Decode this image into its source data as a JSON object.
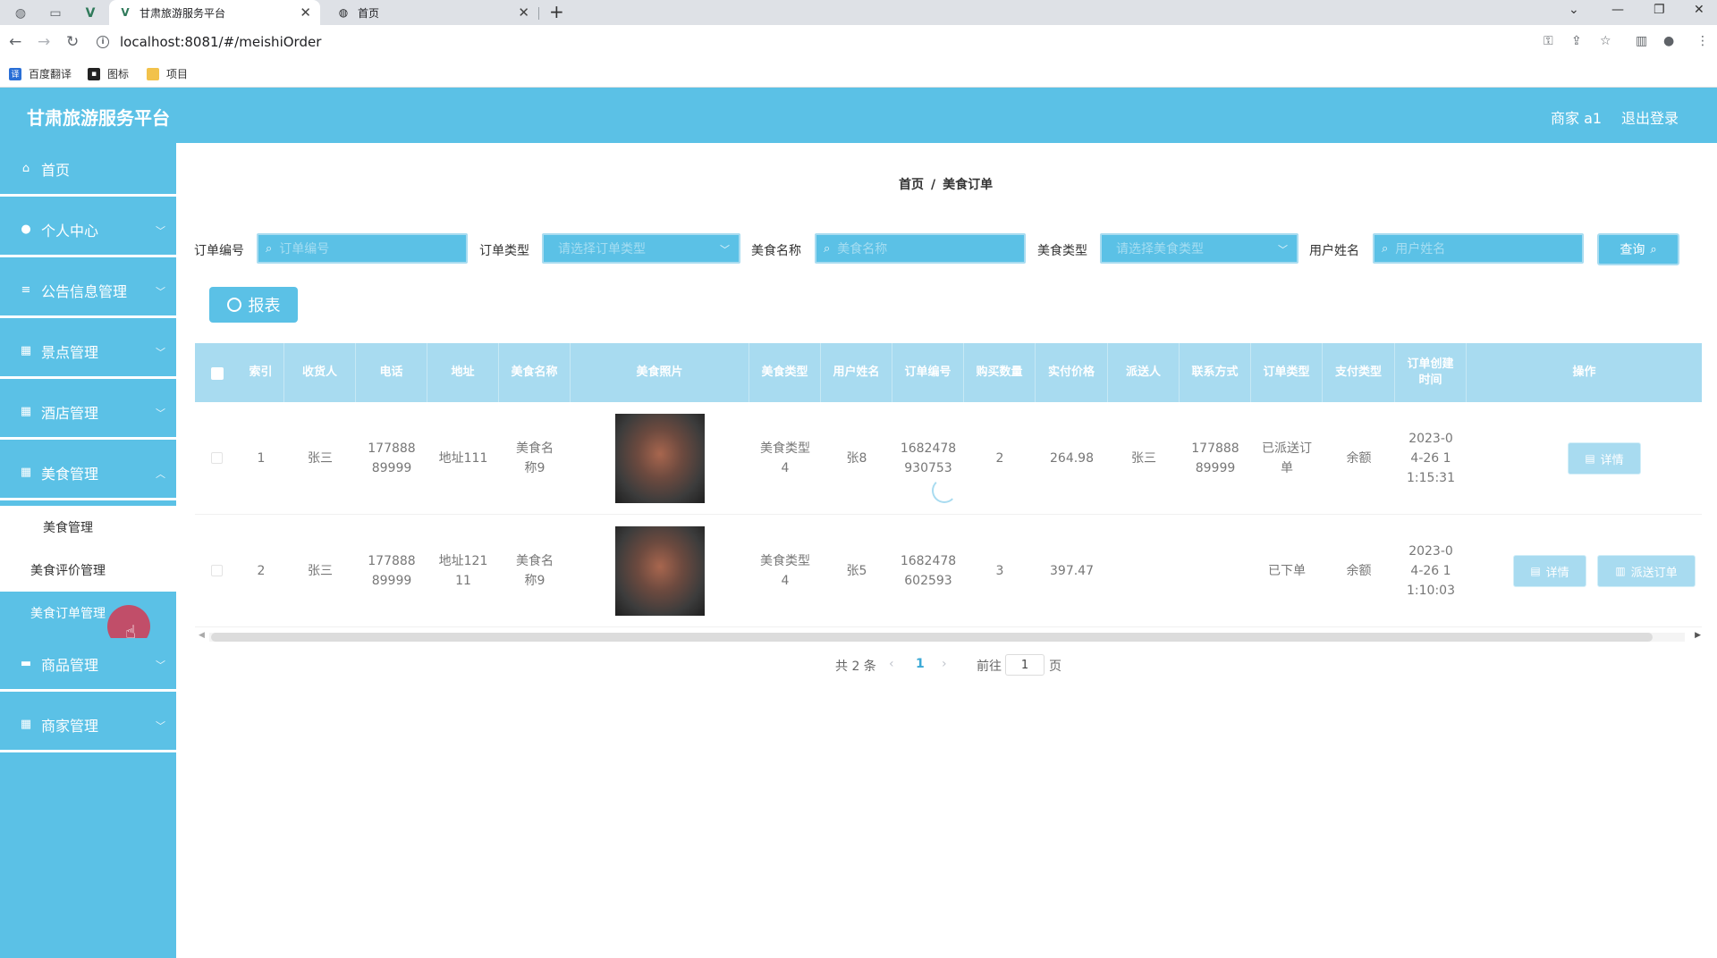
{
  "browser": {
    "tabs": [
      {
        "title": "甘肃旅游服务平台",
        "active": true
      },
      {
        "title": "首页",
        "active": false
      }
    ],
    "url": "localhost:8081/#/meishiOrder",
    "bookmarks": [
      "百度翻译",
      "图标",
      "项目"
    ]
  },
  "app": {
    "title": "甘肃旅游服务平台",
    "user": "商家 a1",
    "logout": "退出登录"
  },
  "sidebar": {
    "items": [
      {
        "label": "首页",
        "icon": "home-icon"
      },
      {
        "label": "个人中心",
        "icon": "user-icon"
      },
      {
        "label": "公告信息管理",
        "icon": "list-icon"
      },
      {
        "label": "景点管理",
        "icon": "grid-icon"
      },
      {
        "label": "酒店管理",
        "icon": "grid-icon"
      },
      {
        "label": "美食管理",
        "icon": "grid-icon"
      },
      {
        "label": "商品管理",
        "icon": "chat-icon"
      },
      {
        "label": "商家管理",
        "icon": "grid-icon"
      }
    ],
    "subitems": [
      "美食管理",
      "美食评价管理",
      "美食订单管理"
    ]
  },
  "breadcrumb": {
    "home": "首页",
    "separator": "/",
    "current": "美食订单"
  },
  "filters": {
    "order_no": {
      "label": "订单编号",
      "placeholder": "订单编号"
    },
    "order_type": {
      "label": "订单类型",
      "placeholder": "请选择订单类型"
    },
    "food_name": {
      "label": "美食名称",
      "placeholder": "美食名称"
    },
    "food_type": {
      "label": "美食类型",
      "placeholder": "请选择美食类型"
    },
    "user_name": {
      "label": "用户姓名",
      "placeholder": "用户姓名"
    },
    "query": "查询"
  },
  "report_button": "报表",
  "table": {
    "headers": [
      "索引",
      "收货人",
      "电话",
      "地址",
      "美食名称",
      "美食照片",
      "美食类型",
      "用户姓名",
      "订单编号",
      "购买数量",
      "实付价格",
      "派送人",
      "联系方式",
      "订单类型",
      "支付类型",
      "订单创建时间",
      "操作"
    ],
    "rows": [
      {
        "index": "1",
        "receiver": "张三",
        "phone": "17788889999",
        "address": "地址111",
        "food_name": "美食名称9",
        "food_type": "美食类型4",
        "user": "张8",
        "order_no": "1682478930753",
        "qty": "2",
        "price": "264.98",
        "courier": "张三",
        "contact": "17788889999",
        "order_type": "已派送订单",
        "pay_type": "余额",
        "created": "2023-04-26 11:15:31",
        "actions": [
          "详情"
        ]
      },
      {
        "index": "2",
        "receiver": "张三",
        "phone": "17788889999",
        "address": "地址12111",
        "food_name": "美食名称9",
        "food_type": "美食类型4",
        "user": "张5",
        "order_no": "1682478602593",
        "qty": "3",
        "price": "397.47",
        "courier": "",
        "contact": "",
        "order_type": "已下单",
        "pay_type": "余额",
        "created": "2023-04-26 11:10:03",
        "actions": [
          "详情",
          "派送订单"
        ]
      }
    ]
  },
  "pagination": {
    "total": "共 2 条",
    "current": "1",
    "goto": "前往",
    "page_input": "1",
    "page_unit": "页"
  },
  "colors": {
    "primary": "#5bc1e6",
    "header_light": "#a8dbf0",
    "cursor": "#d43952"
  }
}
